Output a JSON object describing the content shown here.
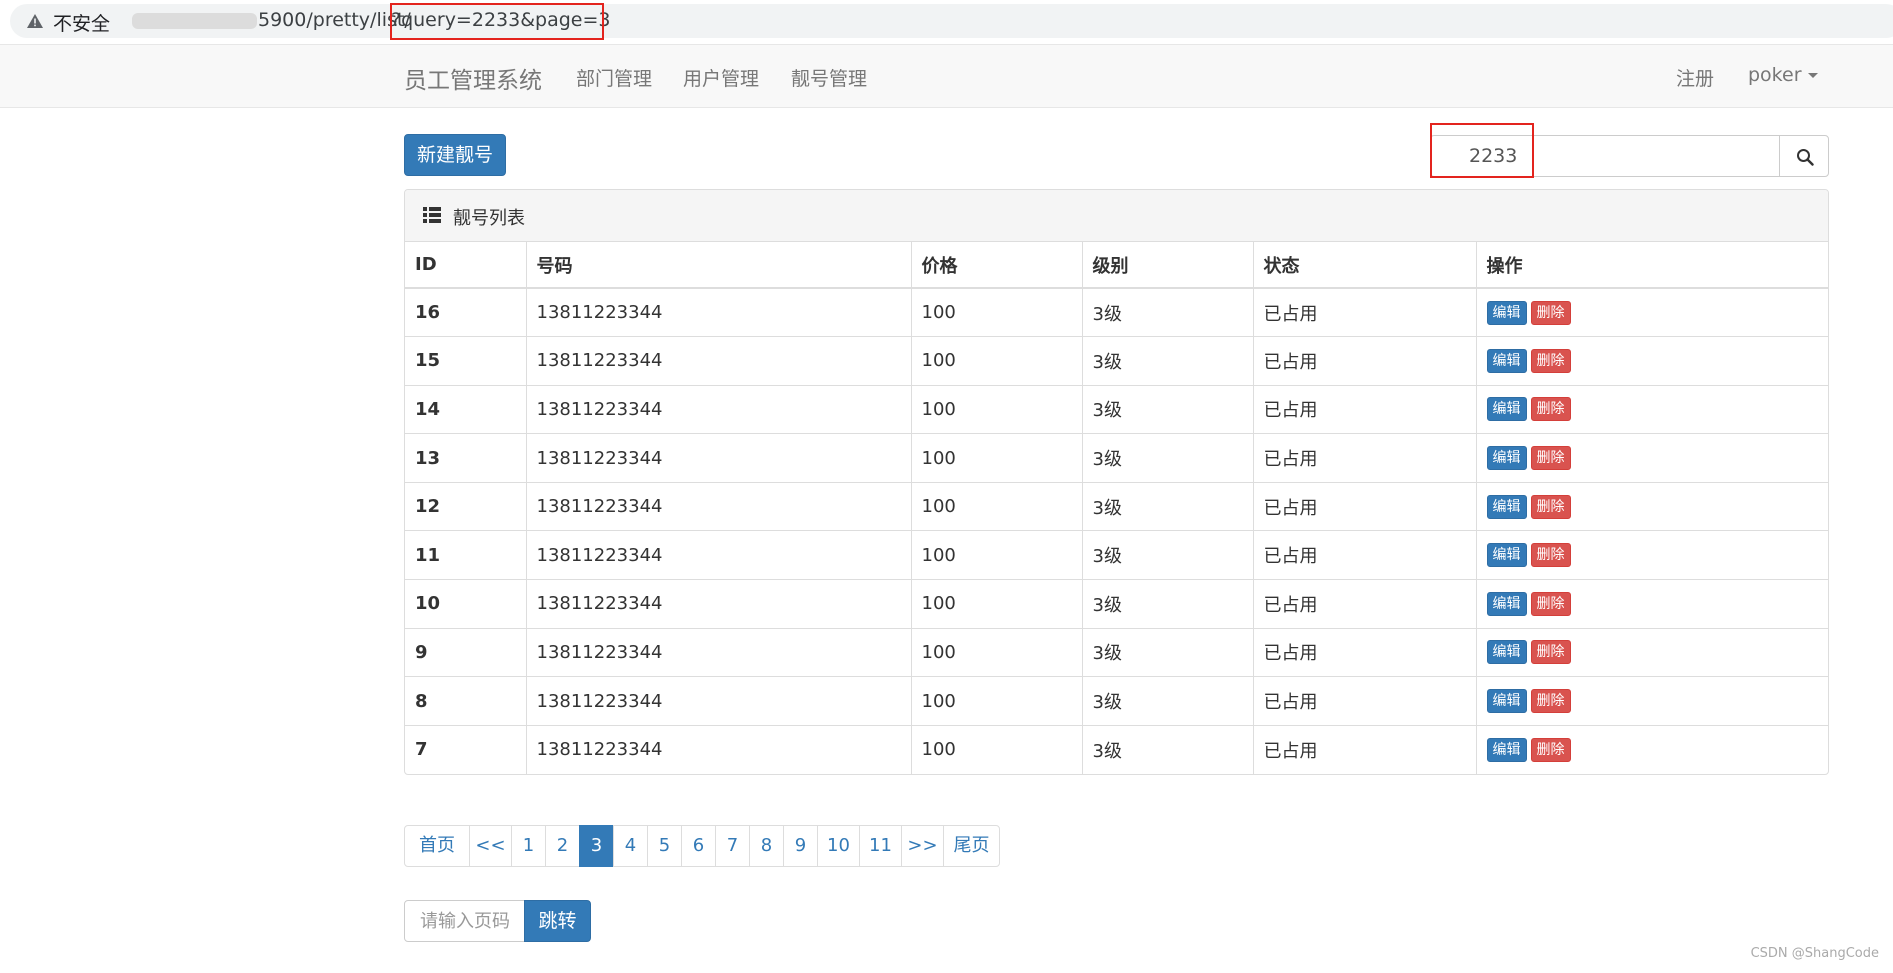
{
  "address_bar": {
    "insecure_label": "不安全",
    "url_visible": "5900/pretty/list/",
    "url_query": "?query=2233&page=3"
  },
  "navbar": {
    "brand": "员工管理系统",
    "links": [
      "部门管理",
      "用户管理",
      "靓号管理"
    ],
    "register": "注册",
    "account": "poker"
  },
  "toolbar": {
    "new_button": "新建靓号",
    "search_value": "2233"
  },
  "panel": {
    "title": "靓号列表",
    "columns": [
      "ID",
      "号码",
      "价格",
      "级别",
      "状态",
      "操作"
    ],
    "edit_label": "编辑",
    "delete_label": "删除",
    "rows": [
      {
        "id": "16",
        "mobile": "13811223344",
        "price": "100",
        "level": "3级",
        "status": "已占用"
      },
      {
        "id": "15",
        "mobile": "13811223344",
        "price": "100",
        "level": "3级",
        "status": "已占用"
      },
      {
        "id": "14",
        "mobile": "13811223344",
        "price": "100",
        "level": "3级",
        "status": "已占用"
      },
      {
        "id": "13",
        "mobile": "13811223344",
        "price": "100",
        "level": "3级",
        "status": "已占用"
      },
      {
        "id": "12",
        "mobile": "13811223344",
        "price": "100",
        "level": "3级",
        "status": "已占用"
      },
      {
        "id": "11",
        "mobile": "13811223344",
        "price": "100",
        "level": "3级",
        "status": "已占用"
      },
      {
        "id": "10",
        "mobile": "13811223344",
        "price": "100",
        "level": "3级",
        "status": "已占用"
      },
      {
        "id": "9",
        "mobile": "13811223344",
        "price": "100",
        "level": "3级",
        "status": "已占用"
      },
      {
        "id": "8",
        "mobile": "13811223344",
        "price": "100",
        "level": "3级",
        "status": "已占用"
      },
      {
        "id": "7",
        "mobile": "13811223344",
        "price": "100",
        "level": "3级",
        "status": "已占用"
      }
    ]
  },
  "pagination": {
    "items": [
      {
        "label": "首页",
        "active": false
      },
      {
        "label": "<<",
        "active": false
      },
      {
        "label": "1",
        "active": false
      },
      {
        "label": "2",
        "active": false
      },
      {
        "label": "3",
        "active": true
      },
      {
        "label": "4",
        "active": false
      },
      {
        "label": "5",
        "active": false
      },
      {
        "label": "6",
        "active": false
      },
      {
        "label": "7",
        "active": false
      },
      {
        "label": "8",
        "active": false
      },
      {
        "label": "9",
        "active": false
      },
      {
        "label": "10",
        "active": false
      },
      {
        "label": "11",
        "active": false
      },
      {
        "label": ">>",
        "active": false
      },
      {
        "label": "尾页",
        "active": false
      }
    ]
  },
  "jump": {
    "placeholder": "请输入页码",
    "button": "跳转"
  },
  "watermark": "CSDN @ShangCode",
  "icons": {
    "warning": "warning-triangle-icon",
    "search": "search-icon",
    "list": "list-icon",
    "caret": "caret-down-icon"
  },
  "colors": {
    "primary": "#337ab7",
    "danger": "#d9534f",
    "highlight": "#e3241e"
  }
}
